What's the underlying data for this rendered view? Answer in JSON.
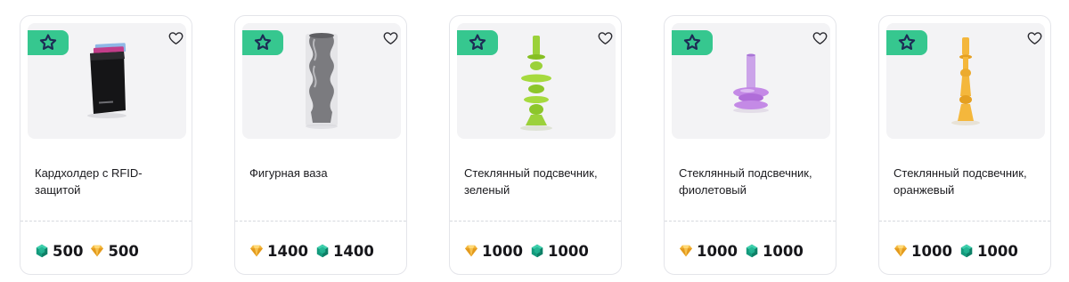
{
  "products": [
    {
      "title": "Кардхолдер с RFID-защитой",
      "prices": [
        {
          "currency_icon": "emerald-coin-icon",
          "value": "500"
        },
        {
          "currency_icon": "gold-diamond-icon",
          "value": "500"
        }
      ]
    },
    {
      "title": "Фигурная ваза",
      "prices": [
        {
          "currency_icon": "gold-diamond-icon",
          "value": "1400"
        },
        {
          "currency_icon": "emerald-coin-icon",
          "value": "1400"
        }
      ]
    },
    {
      "title": "Стеклянный подсвечник, зеленый",
      "prices": [
        {
          "currency_icon": "gold-diamond-icon",
          "value": "1000"
        },
        {
          "currency_icon": "emerald-coin-icon",
          "value": "1000"
        }
      ]
    },
    {
      "title": "Стеклянный подсвечник, фиолетовый",
      "prices": [
        {
          "currency_icon": "gold-diamond-icon",
          "value": "1000"
        },
        {
          "currency_icon": "emerald-coin-icon",
          "value": "1000"
        }
      ]
    },
    {
      "title": "Стеклянный подсвечник, оранжевый",
      "prices": [
        {
          "currency_icon": "gold-diamond-icon",
          "value": "1000"
        },
        {
          "currency_icon": "emerald-coin-icon",
          "value": "1000"
        }
      ]
    }
  ],
  "colors": {
    "badge": "#36c78f",
    "star": "#1d2b55",
    "emerald": "#1aa688",
    "gold": "#f0b63a",
    "thumb_bg": "#f3f3f5"
  },
  "icons": {
    "badge": "star-icon",
    "favorite": "heart-icon"
  }
}
